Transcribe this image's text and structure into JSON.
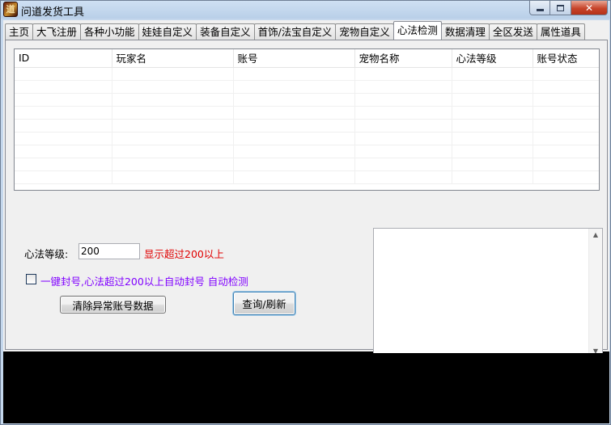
{
  "window": {
    "title": "问道发货工具"
  },
  "tabs": [
    {
      "label": "主页",
      "active": false
    },
    {
      "label": "大飞注册",
      "active": false
    },
    {
      "label": "各种小功能",
      "active": false
    },
    {
      "label": "娃娃自定义",
      "active": false
    },
    {
      "label": "装备自定义",
      "active": false
    },
    {
      "label": "首饰/法宝自定义",
      "active": false
    },
    {
      "label": "宠物自定义",
      "active": false
    },
    {
      "label": "心法检测",
      "active": true
    },
    {
      "label": "数据清理",
      "active": false
    },
    {
      "label": "全区发送",
      "active": false
    },
    {
      "label": "属性道具",
      "active": false
    }
  ],
  "grid": {
    "columns": [
      "ID",
      "玩家名",
      "账号",
      "宠物名称",
      "心法等级",
      "账号状态"
    ],
    "rows": []
  },
  "form": {
    "level_label": "心法等级:",
    "level_value": "200",
    "level_hint": "显示超过200以上",
    "auto_ban_checked": false,
    "auto_ban_label": "一键封号,心法超过200以上自动封号 自动检测",
    "clear_button": "清除异常账号数据",
    "query_button": "查询/刷新",
    "log_text": ""
  },
  "colors": {
    "hint": "#e00000",
    "checkbox_label": "#8000ff"
  },
  "icons": {
    "app": "app-logo-icon",
    "minimize": "minimize-icon",
    "maximize": "maximize-icon",
    "close": "close-icon"
  }
}
